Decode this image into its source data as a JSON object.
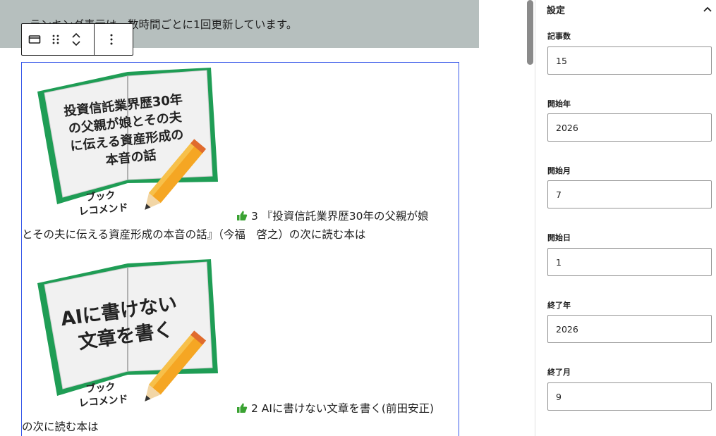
{
  "notice": {
    "text": "ランキング表示は、数時間ごとに1回更新しています。"
  },
  "toolbar": {
    "block_icon": "block-type-icon",
    "drag_icon": "drag-handle-icon",
    "move_up_icon": "chevron-up-icon",
    "move_down_icon": "chevron-down-icon",
    "more_icon": "more-vertical-icon"
  },
  "ranking": {
    "items": [
      {
        "thumb_title": [
          "投資信託業界歴30年",
          "の父親が娘とその夫",
          "に伝える資産形成の",
          "本音の話"
        ],
        "thumb_sub": [
          "ブック",
          "レコメンド"
        ],
        "link_line1": "3 『投資信託業界歴30年の父親が娘",
        "link_line2": "とその夫に伝える資産形成の本音の話』（今福　啓之）の次に読む本は",
        "thumb_icon": "thumbs-up-icon"
      },
      {
        "thumb_title": [
          "AIに書けない",
          "文章を書く"
        ],
        "thumb_sub": [
          "ブック",
          "レコメンド"
        ],
        "link_line1": "2 AIに書けない文章を書く(前田安正)",
        "link_line2": "の次に読む本は",
        "thumb_icon": "thumbs-up-icon"
      }
    ]
  },
  "sidebar": {
    "panel_title": "設定",
    "panel_toggle_icon": "chevron-up-icon",
    "fields": [
      {
        "label": "記事数",
        "value": "15"
      },
      {
        "label": "開始年",
        "value": "2026"
      },
      {
        "label": "開始月",
        "value": "7"
      },
      {
        "label": "開始日",
        "value": "1"
      },
      {
        "label": "終了年",
        "value": "2026"
      },
      {
        "label": "終了月",
        "value": "9"
      }
    ]
  }
}
